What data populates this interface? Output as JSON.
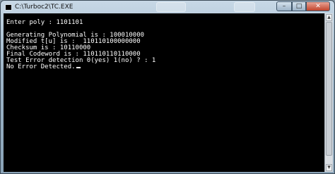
{
  "window": {
    "title": "C:\\Turboc2\\TC.EXE",
    "icon": "console-icon",
    "controls": {
      "minimize": "–",
      "maximize": "□",
      "close": "✕"
    }
  },
  "console": {
    "lines": [
      "Enter poly : 1101101",
      "",
      "Generating Polynomial is : 100010000",
      "Modified t[u] is :  110110100000000",
      "Checksum is : 10110000",
      "Final Codeword is : 110110110110000",
      "Test Error detection 0(yes) 1(no) ? : 1",
      "No Error Detected."
    ]
  }
}
